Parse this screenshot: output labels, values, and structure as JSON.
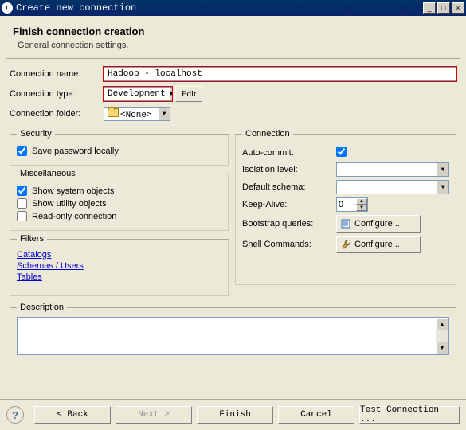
{
  "window": {
    "title": "Create new connection"
  },
  "header": {
    "title": "Finish connection creation",
    "subtitle": "General connection settings."
  },
  "fields": {
    "name_label": "Connection name:",
    "name_value": "Hadoop - localhost",
    "type_label": "Connection type:",
    "type_value": "Development",
    "edit_btn": "Edit",
    "folder_label": "Connection folder:",
    "folder_value": "<None>"
  },
  "security": {
    "legend": "Security",
    "save_pw": "Save password locally",
    "save_pw_checked": true
  },
  "misc": {
    "legend": "Miscellaneous",
    "show_system": "Show system objects",
    "show_system_checked": true,
    "show_utility": "Show utility objects",
    "show_utility_checked": false,
    "readonly": "Read-only connection",
    "readonly_checked": false
  },
  "filters": {
    "legend": "Filters",
    "catalogs": "Catalogs",
    "schemas": "Schemas / Users",
    "tables": "Tables"
  },
  "connection": {
    "legend": "Connection",
    "auto_commit": "Auto-commit:",
    "auto_commit_checked": true,
    "isolation": "Isolation level:",
    "isolation_value": "",
    "schema": "Default schema:",
    "schema_value": "",
    "keepalive": "Keep-Alive:",
    "keepalive_value": "0",
    "bootstrap": "Bootstrap queries:",
    "shell": "Shell Commands:",
    "configure": "Configure ..."
  },
  "description": {
    "legend": "Description",
    "value": ""
  },
  "buttons": {
    "back": "< Back",
    "next": "Next >",
    "finish": "Finish",
    "cancel": "Cancel",
    "test": "Test Connection ..."
  }
}
